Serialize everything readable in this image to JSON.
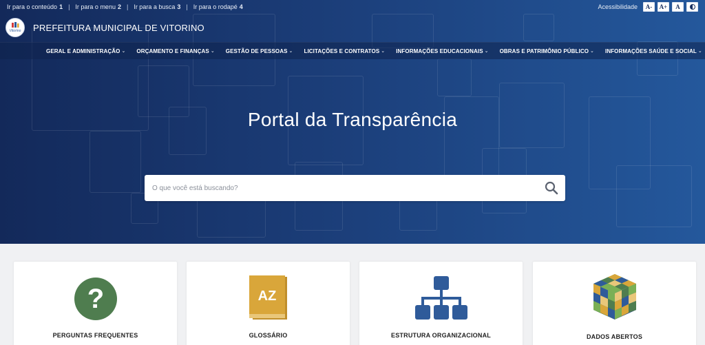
{
  "skip_links": [
    {
      "label": "Ir para o conteúdo",
      "key": "1"
    },
    {
      "label": "Ir para o menu",
      "key": "2"
    },
    {
      "label": "Ir para a busca",
      "key": "3"
    },
    {
      "label": "Ir para o rodapé",
      "key": "4"
    }
  ],
  "accessibility": {
    "label": "Acessibilidade",
    "decrease_label": "A-",
    "increase_label": "A+",
    "reset_label": "A",
    "contrast_icon": "contrast-icon"
  },
  "header": {
    "logo_text": "Vitorino",
    "title": "PREFEITURA MUNICIPAL DE VITORINO"
  },
  "nav": {
    "items": [
      {
        "label": "GERAL E ADMINISTRAÇÃO"
      },
      {
        "label": "ORÇAMENTO E FINANÇAS"
      },
      {
        "label": "GESTÃO DE PESSOAS"
      },
      {
        "label": "LICITAÇÕES E CONTRATOS"
      },
      {
        "label": "INFORMAÇÕES EDUCACIONAIS"
      },
      {
        "label": "OBRAS E PATRIMÔNIO PÚBLICO"
      },
      {
        "label": "INFORMAÇÕES SAÚDE E SOCIAL"
      }
    ],
    "chevron": "⌄"
  },
  "hero": {
    "title": "Portal da Transparência",
    "search_placeholder": "O que você está buscando?"
  },
  "cards": [
    {
      "label": "PERGUNTAS FREQUENTES",
      "icon": "question-icon",
      "icon_text": "?",
      "color": "#4f7d4f"
    },
    {
      "label": "GLOSSÁRIO",
      "icon": "glossary-book-icon",
      "icon_text": "AZ",
      "color": "#d9a63a"
    },
    {
      "label": "ESTRUTURA ORGANIZACIONAL",
      "icon": "org-chart-icon",
      "color": "#2f5b9a"
    },
    {
      "label": "DADOS ABERTOS",
      "icon": "open-data-cube-icon"
    }
  ],
  "colors": {
    "header_dark": "#13295a",
    "header_light": "#24589c",
    "page_bg": "#f0f1f3"
  }
}
